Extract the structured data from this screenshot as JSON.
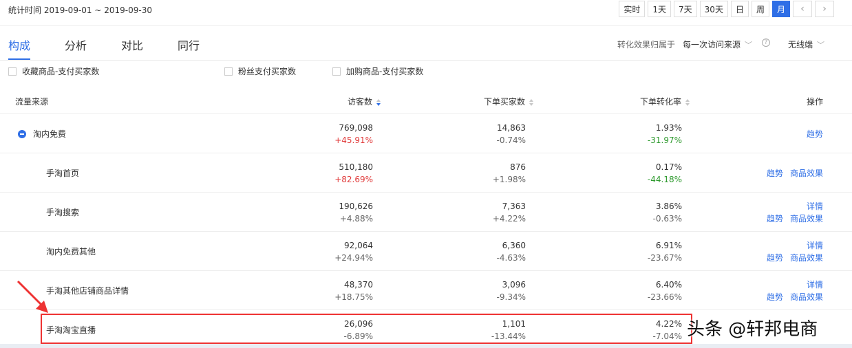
{
  "header": {
    "stat_time": "统计时间 2019-09-01 ~ 2019-09-30",
    "ranges": [
      "实时",
      "1天",
      "7天",
      "30天",
      "日",
      "周",
      "月"
    ],
    "active_range": "月",
    "prev_icon": "chevron-left-icon",
    "next_icon": "chevron-right-icon"
  },
  "tabs": [
    {
      "label": "构成",
      "active": true
    },
    {
      "label": "分析",
      "active": false
    },
    {
      "label": "对比",
      "active": false
    },
    {
      "label": "同行",
      "active": false
    }
  ],
  "attribution": {
    "label": "转化效果归属于",
    "selected": "每一次访问来源",
    "device": "无线端"
  },
  "checkboxes": [
    "收藏商品-支付买家数",
    "粉丝支付买家数",
    "加购商品-支付买家数"
  ],
  "table": {
    "columns": [
      "流量来源",
      "访客数",
      "下单买家数",
      "下单转化率",
      "操作"
    ],
    "rows": [
      {
        "name": "淘内免费",
        "visitors": "769,098",
        "visitors_chg": "+45.91%",
        "buyers": "14,863",
        "buyers_chg": "-0.74%",
        "rate": "1.93%",
        "rate_chg": "-31.97%",
        "ops": [
          "趋势"
        ],
        "group": true
      },
      {
        "name": "手淘首页",
        "visitors": "510,180",
        "visitors_chg": "+82.69%",
        "buyers": "876",
        "buyers_chg": "+1.98%",
        "rate": "0.17%",
        "rate_chg": "-44.18%",
        "ops": [
          "趋势",
          "商品效果"
        ]
      },
      {
        "name": "手淘搜索",
        "visitors": "190,626",
        "visitors_chg": "+4.88%",
        "buyers": "7,363",
        "buyers_chg": "+4.22%",
        "rate": "3.86%",
        "rate_chg": "-0.63%",
        "ops_top": "详情",
        "ops": [
          "趋势",
          "商品效果"
        ]
      },
      {
        "name": "淘内免费其他",
        "visitors": "92,064",
        "visitors_chg": "+24.94%",
        "buyers": "6,360",
        "buyers_chg": "-4.63%",
        "rate": "6.91%",
        "rate_chg": "-23.67%",
        "ops_top": "详情",
        "ops": [
          "趋势",
          "商品效果"
        ]
      },
      {
        "name": "手淘其他店铺商品详情",
        "visitors": "48,370",
        "visitors_chg": "+18.75%",
        "buyers": "3,096",
        "buyers_chg": "-9.34%",
        "rate": "6.40%",
        "rate_chg": "-23.66%",
        "ops_top": "详情",
        "ops": [
          "趋势",
          "商品效果"
        ]
      },
      {
        "name": "手淘淘宝直播",
        "visitors": "26,096",
        "visitors_chg": "-6.89%",
        "buyers": "1,101",
        "buyers_chg": "-13.44%",
        "rate": "4.22%",
        "rate_chg": "-7.04%",
        "ops": []
      }
    ]
  },
  "watermark": "头条 @轩邦电商",
  "colors": {
    "accent": "#2e6ee6",
    "up": "#e03a3a",
    "down": "#2e9a2e",
    "highlight": "#e33"
  }
}
